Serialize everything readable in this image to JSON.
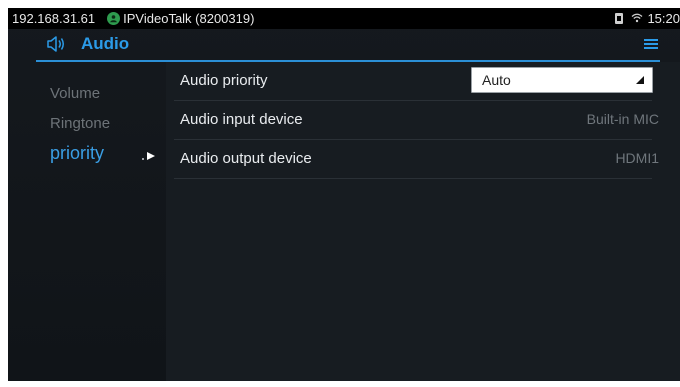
{
  "status_bar": {
    "ip": "192.168.31.61",
    "account": "IPVideoTalk (8200319)",
    "time": "15:20",
    "icons": [
      "account-status-icon",
      "sim-icon",
      "wifi-icon"
    ]
  },
  "header": {
    "title": "Audio",
    "icons": [
      "speaker-icon",
      "menu-icon"
    ]
  },
  "sidebar": {
    "items": [
      {
        "label": "Volume",
        "active": false
      },
      {
        "label": "Ringtone",
        "active": false
      },
      {
        "label": "priority",
        "active": true
      }
    ]
  },
  "settings": {
    "rows": [
      {
        "label": "Audio priority",
        "type": "select",
        "value": "Auto"
      },
      {
        "label": "Audio input device",
        "type": "text",
        "value": "Built-in MIC"
      },
      {
        "label": "Audio output device",
        "type": "text",
        "value": "HDMI1"
      }
    ]
  },
  "colors": {
    "accent": "#2b9be8",
    "background": "#15191e",
    "active_nav": "#3a9ee4",
    "account_status": "#2e9b4e"
  }
}
